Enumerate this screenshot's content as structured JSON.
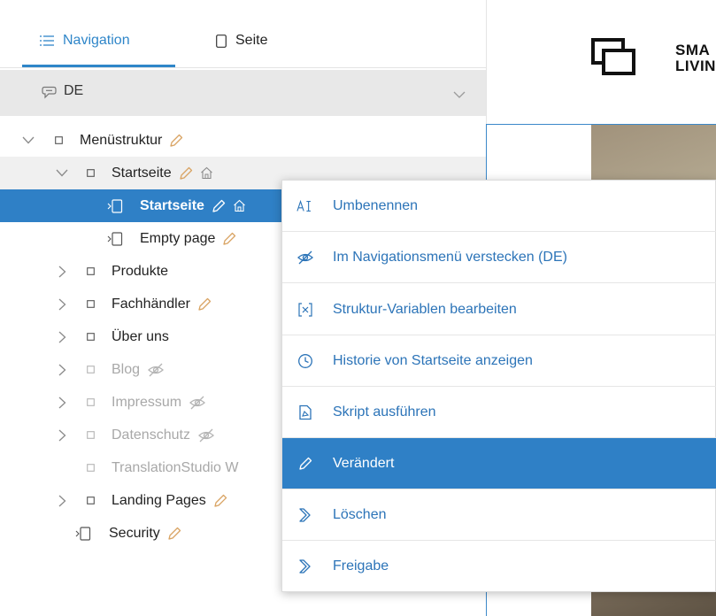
{
  "tabs": {
    "navigation": "Navigation",
    "page": "Seite"
  },
  "language": {
    "value": "DE"
  },
  "tree": [
    {
      "label": "Menüstruktur",
      "icons": [
        "pencil-icon"
      ]
    },
    {
      "label": "Startseite",
      "icons": [
        "pencil-icon",
        "home-icon"
      ]
    },
    {
      "label": "Startseite",
      "icons": [
        "pencil-icon",
        "home-icon"
      ],
      "selected": true
    },
    {
      "label": "Empty page",
      "icons": [
        "pencil-icon"
      ]
    },
    {
      "label": "Produkte",
      "icons": []
    },
    {
      "label": "Fachhändler",
      "icons": [
        "pencil-icon"
      ]
    },
    {
      "label": "Über uns",
      "icons": []
    },
    {
      "label": "Blog",
      "icons": [
        "hidden-icon"
      ],
      "muted": true
    },
    {
      "label": "Impressum",
      "icons": [
        "hidden-icon"
      ],
      "muted": true
    },
    {
      "label": "Datenschutz",
      "icons": [
        "hidden-icon"
      ],
      "muted": true
    },
    {
      "label": "TranslationStudio W",
      "icons": [],
      "muted": true
    },
    {
      "label": "Landing Pages",
      "icons": [
        "pencil-icon"
      ]
    },
    {
      "label": "Security",
      "icons": [
        "pencil-icon"
      ]
    }
  ],
  "preview": {
    "brand": "SMA\nLIVIN"
  },
  "context_menu": [
    {
      "label": "Umbenennen",
      "icon": "rename-icon"
    },
    {
      "label": "Im Navigationsmenü verstecken (DE)",
      "icon": "hidden-icon"
    },
    {
      "label": "Struktur-Variablen bearbeiten",
      "icon": "variables-icon"
    },
    {
      "label": "Historie von Startseite anzeigen",
      "icon": "history-icon"
    },
    {
      "label": "Skript ausführen",
      "icon": "script-icon"
    },
    {
      "label": "Verändert",
      "icon": "pencil-icon",
      "active": true
    },
    {
      "label": "Löschen",
      "icon": "workflow-icon"
    },
    {
      "label": "Freigabe",
      "icon": "workflow-icon"
    }
  ],
  "colors": {
    "accent": "#2f80c6",
    "edit_icon": "#d9a464",
    "muted_text": "#a8a8a8"
  }
}
